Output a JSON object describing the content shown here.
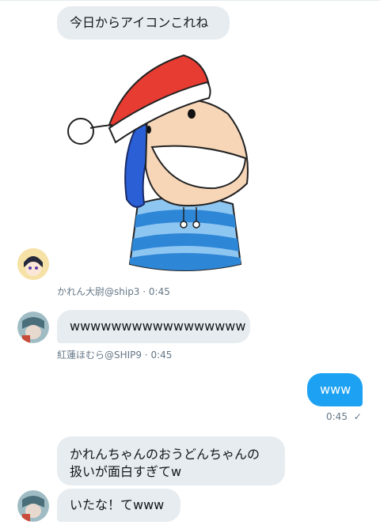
{
  "messages": [
    {
      "id": "m1",
      "text": "今日からアイコンこれね"
    },
    {
      "id": "m2",
      "sticker": "santa-hat-character-sticker",
      "sender": "かれん大尉@ship3",
      "time": "0:45"
    },
    {
      "id": "m3",
      "text": "wwwwwwwwwwwwwwwww",
      "sender": "紅蓮ほむら@SHIP9",
      "time": "0:45"
    },
    {
      "id": "m4",
      "text": "www",
      "time": "0:45",
      "status_icon": "read-check-icon",
      "status_glyph": "✓"
    },
    {
      "id": "m5",
      "text": "かれんちゃんのおうどんちゃんの\n扱いが面白すぎてw"
    },
    {
      "id": "m6",
      "text": "いたな！てwww"
    }
  ],
  "meta": {
    "m2_line": "かれん大尉@ship3 · 0:45",
    "m3_line": "紅蓮ほむら@SHIP9 · 0:45",
    "m4_time": "0:45"
  },
  "colors": {
    "bubble_incoming": "#e6ecf0",
    "bubble_outgoing": "#1da1f2",
    "meta_text": "#657786"
  }
}
